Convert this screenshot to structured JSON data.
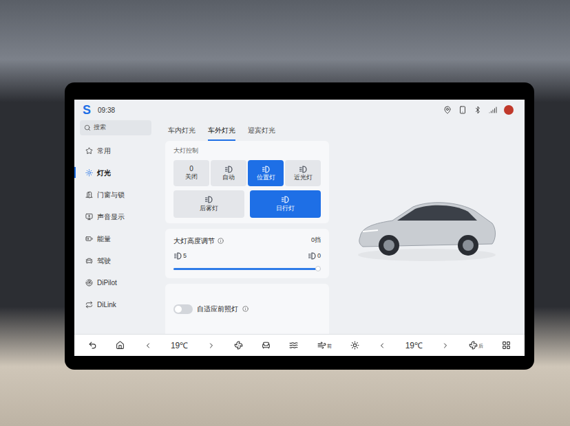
{
  "status_bar": {
    "logo": "S",
    "time": "09:38"
  },
  "sidebar": {
    "search_placeholder": "搜索",
    "items": [
      {
        "label": "常用",
        "selected": false
      },
      {
        "label": "灯光",
        "selected": true
      },
      {
        "label": "门窗与锁",
        "selected": false
      },
      {
        "label": "声音显示",
        "selected": false
      },
      {
        "label": "能量",
        "selected": false
      },
      {
        "label": "驾驶",
        "selected": false
      },
      {
        "label": "DiPilot",
        "selected": false
      },
      {
        "label": "DiLink",
        "selected": false
      }
    ]
  },
  "tabs": [
    {
      "label": "车内灯光",
      "selected": false
    },
    {
      "label": "车外灯光",
      "selected": true
    },
    {
      "label": "迎宾灯光",
      "selected": false
    }
  ],
  "headlight_control": {
    "title": "大灯控制",
    "modes": [
      {
        "icon_text": "0",
        "label": "关闭",
        "selected": false
      },
      {
        "icon_text": "",
        "label": "自动",
        "selected": false
      },
      {
        "icon_text": "",
        "label": "位置灯",
        "selected": true
      },
      {
        "icon_text": "",
        "label": "近光灯",
        "selected": false
      }
    ],
    "lights": [
      {
        "label": "后雾灯",
        "on": false
      },
      {
        "label": "日行灯",
        "on": true
      }
    ]
  },
  "height_adjust": {
    "title": "大灯高度调节",
    "reading": "0挡",
    "min_label": "5",
    "max_label": "0",
    "level": 0.98
  },
  "adaptive_headlight": {
    "label": "自适应前照灯",
    "on": false
  },
  "bottom_bar": {
    "left_temp": "19℃",
    "right_temp": "19℃",
    "front_defrost_label": "前",
    "rear_label": "后"
  }
}
